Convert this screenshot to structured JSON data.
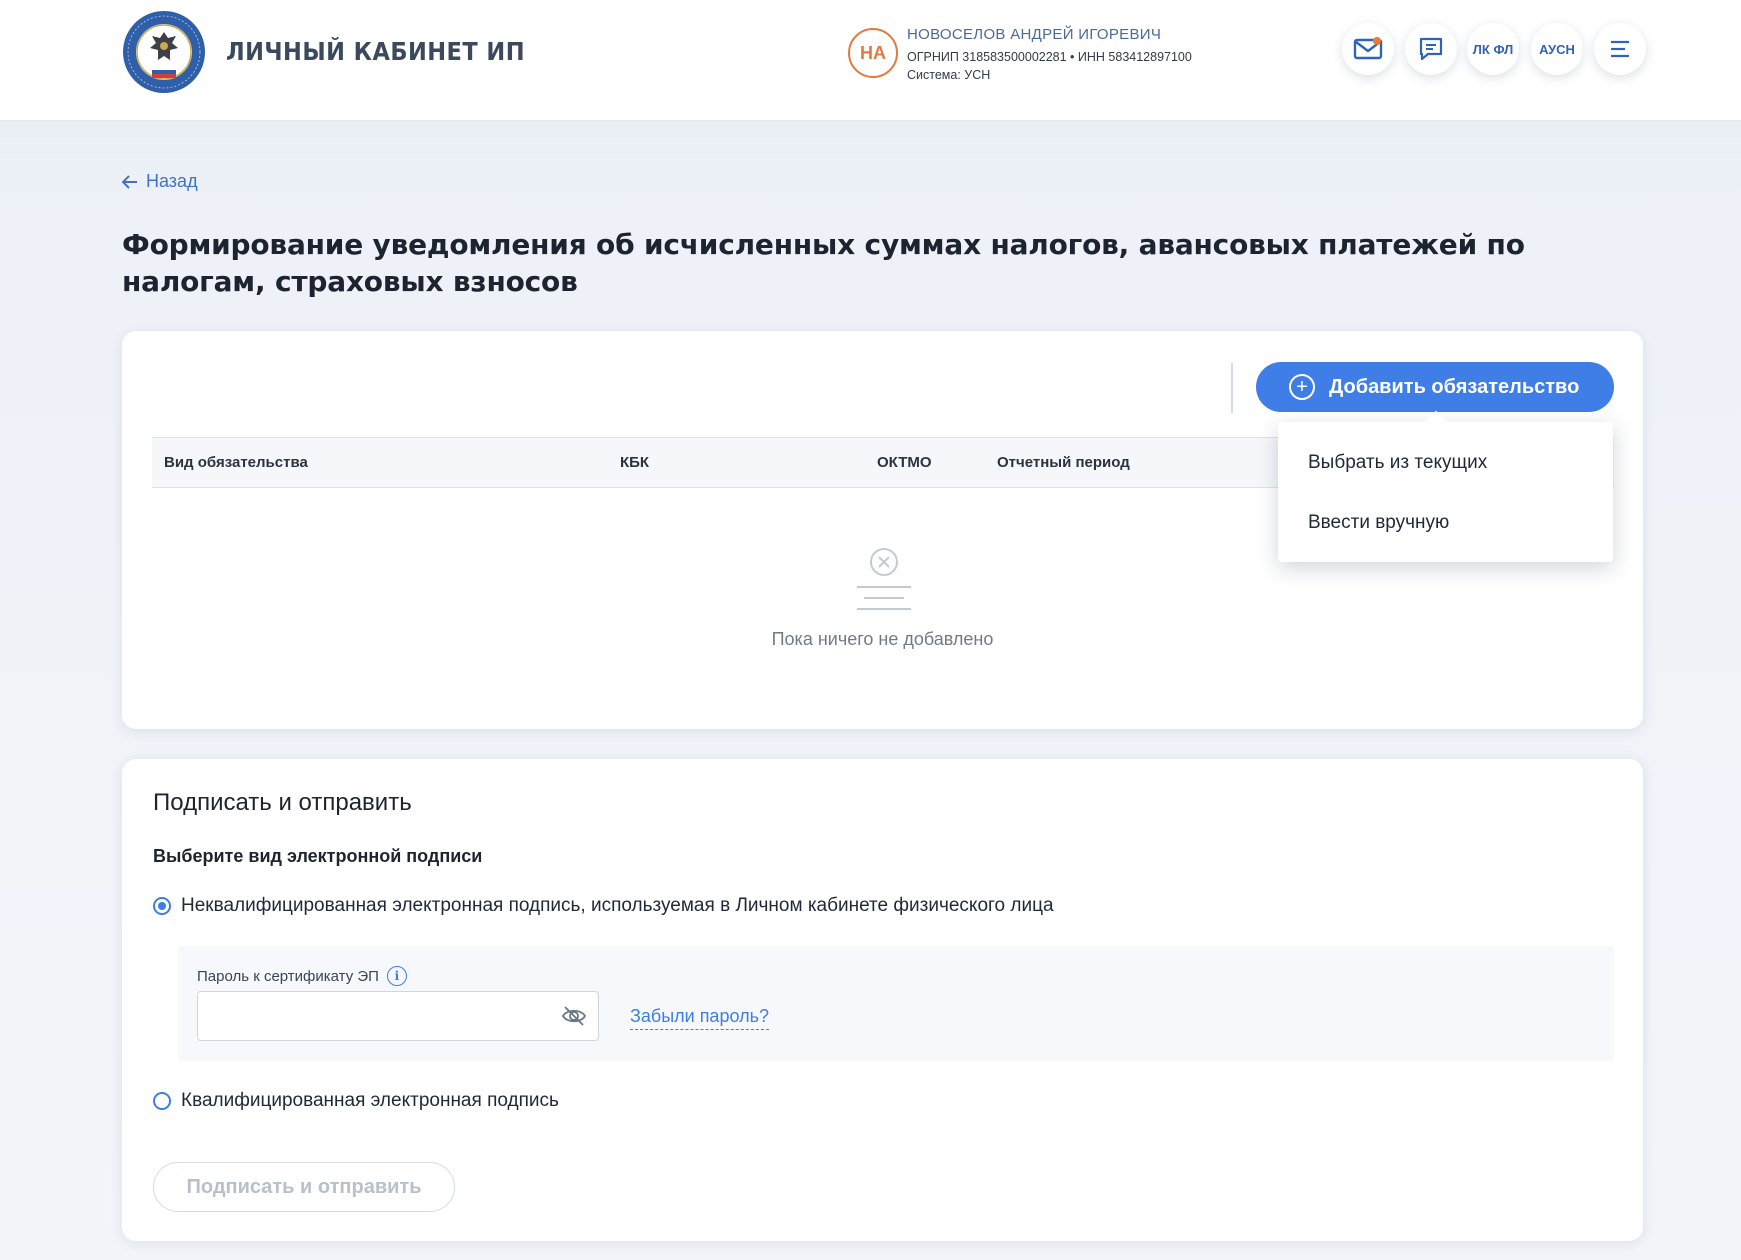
{
  "header": {
    "app_title": "ЛИЧНЫЙ КАБИНЕТ ИП",
    "logo_text": "ФЕДЕРАЛЬНАЯ НАЛОГОВАЯ СЛУЖБА",
    "user": {
      "initials": "НА",
      "name": "НОВОСЕЛОВ АНДРЕЙ ИГОРЕВИЧ",
      "ids": "ОГРНИП 318583500002281 • ИНН 583412897100",
      "system": "Система: УСН"
    },
    "buttons": {
      "mail_icon": "mail-icon",
      "chat_icon": "chat-icon",
      "lk_fl": "ЛК ФЛ",
      "ausn": "АУСН",
      "menu_icon": "hamburger-menu-icon"
    }
  },
  "nav": {
    "back": "Назад"
  },
  "page": {
    "title": "Формирование уведомления об исчисленных суммах налогов, авансовых платежей по налогам, страховых взносов"
  },
  "obligations": {
    "add_button": "Добавить обязательство",
    "columns": [
      "Вид обязательства",
      "КБК",
      "ОКТМО",
      "Отчетный период"
    ],
    "empty_text": "Пока ничего не добавлено",
    "dropdown": [
      "Выбрать из текущих",
      "Ввести вручную"
    ]
  },
  "sign": {
    "title": "Подписать и отправить",
    "subtitle": "Выберите вид электронной подписи",
    "options": [
      "Неквалифицированная электронная подпись, используемая в Личном кабинете физического лица",
      "Квалифицированная электронная подпись"
    ],
    "selected_option": 0,
    "password_label": "Пароль к сертификату ЭП",
    "password_value": "",
    "forgot_link": "Забыли пароль?",
    "submit_button": "Подписать и отправить"
  },
  "colors": {
    "accent": "#3e7ee6",
    "avatar": "#e27a3f",
    "notification_dot": "#e77a3a",
    "disabled_text": "#b8c0cb"
  }
}
